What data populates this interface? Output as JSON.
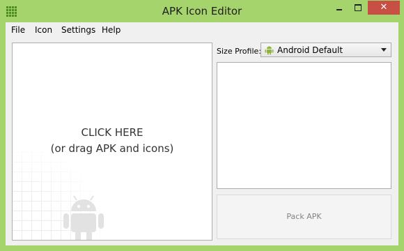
{
  "window": {
    "title": "APK Icon Editor",
    "close_label": "✕"
  },
  "menu": {
    "items": [
      "File",
      "Icon",
      "Settings",
      "Help"
    ]
  },
  "drop_area": {
    "line1": "CLICK HERE",
    "line2": "(or drag APK and icons)"
  },
  "size_profile": {
    "label": "Size Profile:",
    "value": "Android Default"
  },
  "pack_button": {
    "label": "Pack APK",
    "enabled": false
  },
  "colors": {
    "frame": "#a6d46c",
    "android_green": "#8fb43a",
    "close": "#c74f44"
  },
  "icons": {
    "app": "grid-icon",
    "profile": "android-icon",
    "watermark": "android-icon"
  }
}
